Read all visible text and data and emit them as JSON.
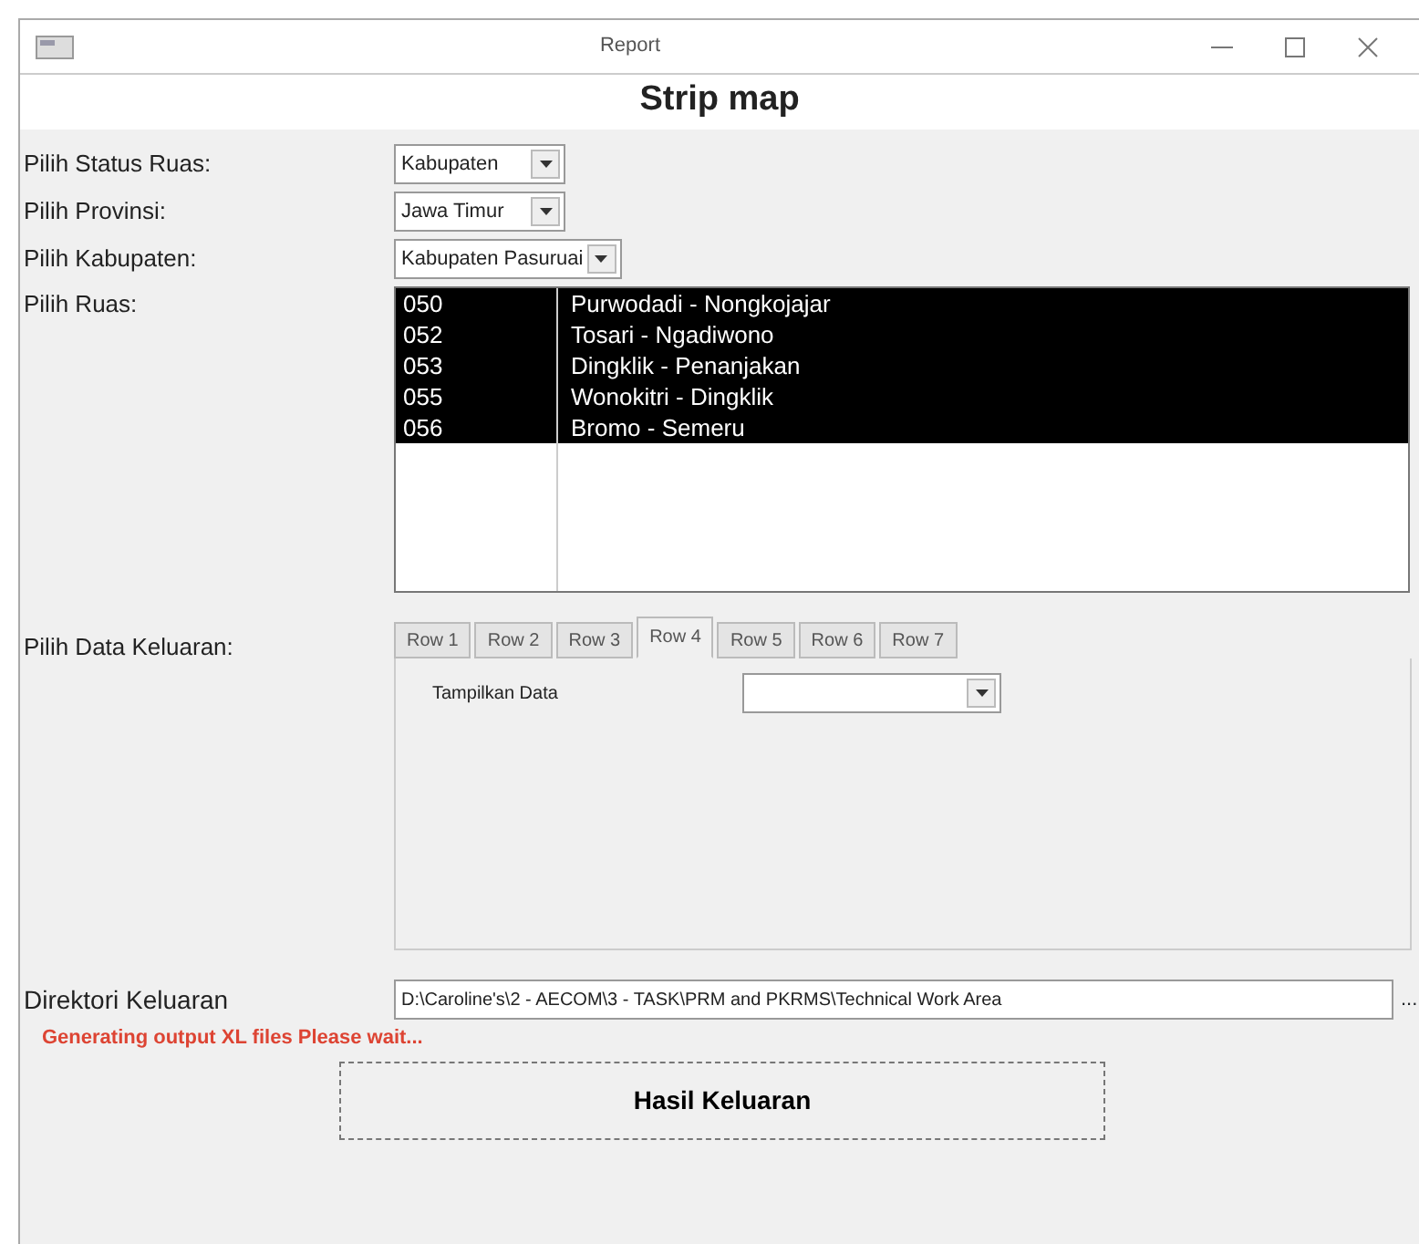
{
  "window": {
    "title": "Report"
  },
  "heading": "Strip map",
  "selectors": [
    {
      "label": "Pilih Status Ruas:",
      "value": "Kabupaten"
    },
    {
      "label": "Pilih Provinsi:",
      "value": "Jawa Timur"
    },
    {
      "label": "Pilih Kabupaten:",
      "value": "Kabupaten Pasuruai"
    }
  ],
  "ruas": {
    "label": "Pilih Ruas:",
    "items": [
      {
        "code": "050",
        "name": "Purwodadi - Nongkojajar",
        "selected": true
      },
      {
        "code": "052",
        "name": "Tosari - Ngadiwono",
        "selected": true
      },
      {
        "code": "053",
        "name": "Dingklik - Penanjakan",
        "selected": true
      },
      {
        "code": "055",
        "name": "Wonokitri - Dingklik",
        "selected": true
      },
      {
        "code": "056",
        "name": "Bromo - Semeru",
        "selected": true
      }
    ]
  },
  "output_data": {
    "label": "Pilih Data Keluaran:",
    "tabs": [
      {
        "label": "Row 1",
        "selected": false
      },
      {
        "label": "Row 2",
        "selected": false
      },
      {
        "label": "Row 3",
        "selected": false
      },
      {
        "label": "Row 4",
        "selected": true
      },
      {
        "label": "Row 5",
        "selected": false
      },
      {
        "label": "Row 6",
        "selected": false
      },
      {
        "label": "Row 7",
        "selected": false
      }
    ],
    "field_label": "Tampilkan Data"
  },
  "directory": {
    "label": "Direktori Keluaran",
    "value": "D:\\Caroline's\\2 - AECOM\\3 - TASK\\PRM and PKRMS\\Technical Work Area",
    "browse": "..."
  },
  "status": "Generating output XL files Please wait...",
  "button": "Hasil Keluaran"
}
